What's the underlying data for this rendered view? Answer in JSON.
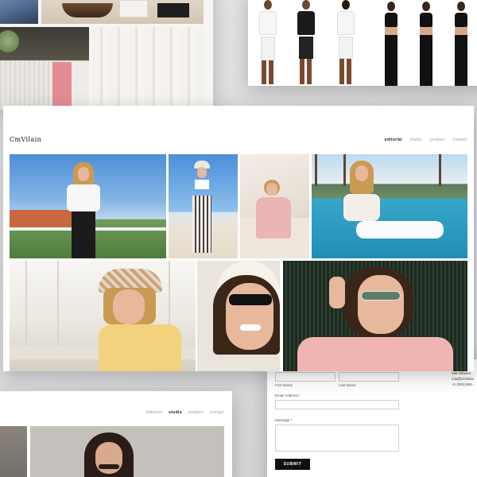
{
  "main": {
    "logo": "CmVilain",
    "nav": [
      "editorial",
      "studio",
      "product",
      "contact"
    ],
    "active_nav": "editorial"
  },
  "bottom_left": {
    "nav": [
      "editorial",
      "studio",
      "product",
      "contact"
    ],
    "active_nav": "studio"
  },
  "contact_form": {
    "first_name_label": "First Name",
    "last_name_label": "Last Name",
    "email_label": "Email Address *",
    "message_label": "Message *",
    "submit_label": "SUBMIT",
    "side_name": "Mia Villasen",
    "side_email": "mia@cmvilain",
    "side_phone": "+1 (305) 804-"
  },
  "colors": {
    "accent": "#111111",
    "nav_inactive": "#999999"
  }
}
